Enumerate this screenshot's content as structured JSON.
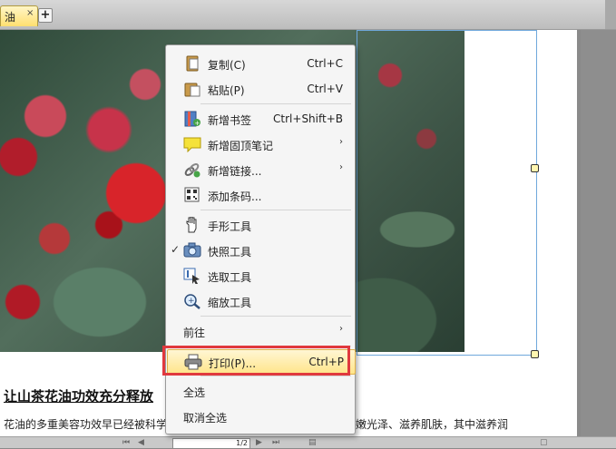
{
  "tab": {
    "title": "油",
    "close": "×",
    "add": "+"
  },
  "document": {
    "heading": "让山茶花油功效充分释放",
    "body_left": "花油的多重美容功效早已经被科学",
    "body_right": "嫩光泽、滋养肌肤，其中滋养润"
  },
  "navbar": {
    "page_value": "1/2"
  },
  "context_menu": {
    "items": [
      {
        "label": "复制(C)",
        "shortcut": "Ctrl+C",
        "icon": "copy-icon"
      },
      {
        "label": "粘贴(P)",
        "shortcut": "Ctrl+V",
        "icon": "paste-icon"
      },
      {
        "label": "新增书签",
        "shortcut": "Ctrl+Shift+B",
        "icon": "bookmark-add-icon"
      },
      {
        "label": "新增固顶笔记",
        "shortcut": "",
        "icon": "sticky-note-icon",
        "submenu": true
      },
      {
        "label": "新增链接...",
        "shortcut": "",
        "icon": "link-icon",
        "submenu": true
      },
      {
        "label": "添加条码...",
        "shortcut": "",
        "icon": "barcode-icon"
      },
      {
        "label": "手形工具",
        "shortcut": "",
        "icon": "hand-icon"
      },
      {
        "label": "快照工具",
        "shortcut": "",
        "icon": "camera-icon",
        "checked": true
      },
      {
        "label": "选取工具",
        "shortcut": "",
        "icon": "select-text-icon"
      },
      {
        "label": "缩放工具",
        "shortcut": "",
        "icon": "zoom-icon"
      },
      {
        "label": "前往",
        "shortcut": "",
        "icon": "",
        "submenu": true
      },
      {
        "label": "打印(P)...",
        "shortcut": "Ctrl+P",
        "icon": "printer-icon",
        "highlighted": true
      },
      {
        "label": "全选",
        "shortcut": "",
        "icon": ""
      },
      {
        "label": "取消全选",
        "shortcut": "",
        "icon": ""
      }
    ],
    "submenu_arrow": "›",
    "check_mark": "✓"
  },
  "colors": {
    "highlight_border": "#e0393e",
    "menu_highlight": "#ffe58a",
    "tab_active": "#ffe070"
  }
}
